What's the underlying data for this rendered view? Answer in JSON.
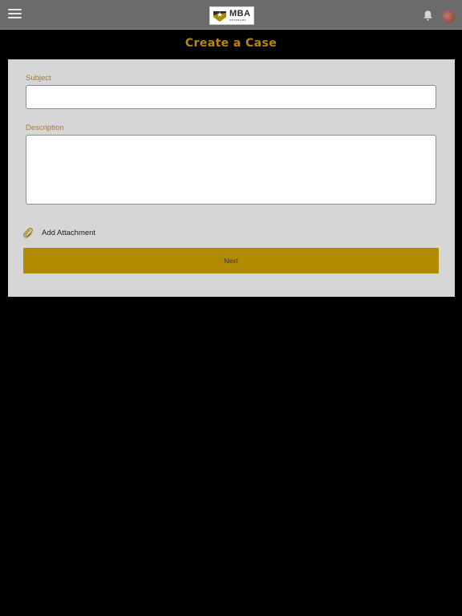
{
  "header": {
    "menu_icon": "hamburger-menu-icon",
    "logo": {
      "title": "MBA",
      "subtitle": "VETERANS"
    },
    "notification_icon": "bell-icon",
    "avatar": "user-avatar"
  },
  "page": {
    "title": "Create a Case"
  },
  "form": {
    "subject_label": "Subject",
    "subject_value": "",
    "description_label": "Description",
    "description_value": "",
    "attachment_icon": "paperclip-icon",
    "attachment_label": "Add Attachment",
    "next_label": "Next"
  },
  "colors": {
    "accent": "#b08a00",
    "title": "#b8860b",
    "label": "#a37f1a",
    "topbar": "#6b6b6b",
    "card": "#d6d6d6",
    "background": "#000000"
  }
}
